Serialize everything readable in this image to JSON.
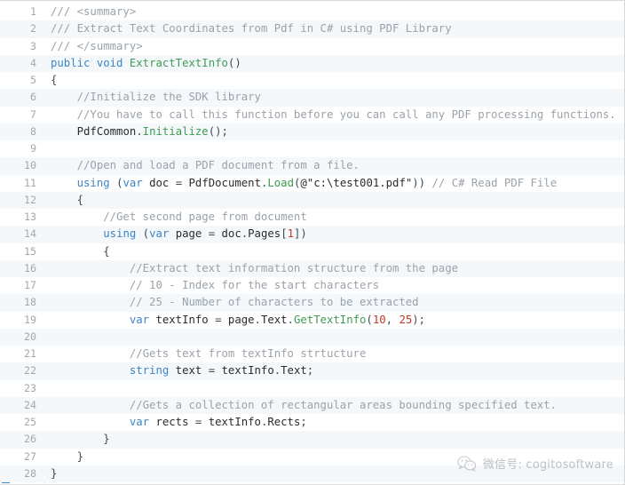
{
  "viewer": {
    "language": "csharp",
    "accent_color": "#4584c4",
    "stripe_color": "#f4f8fb",
    "background_color": "#ffffff",
    "gutter_text_color": "#a0a8b0",
    "total_lines": 28,
    "first_line_number": 1
  },
  "palette": {
    "comment": "#9aa2ab",
    "keyword": "#3d85c6",
    "method": "#3f9c52",
    "number": "#c0392b",
    "string": "#2b2b2b",
    "punctuation": "#3b4a57",
    "plain": "#2b2b2b"
  },
  "watermark": {
    "icon": "wechat-icon",
    "label": "微信号: cogitosoftware"
  },
  "code": {
    "lines": [
      {
        "n": "1",
        "tokens": [
          {
            "c": "doc",
            "t": "/// <summary>"
          }
        ]
      },
      {
        "n": "2",
        "tokens": [
          {
            "c": "doc",
            "t": "/// Extract Text Coordinates from Pdf in C# using PDF Library"
          }
        ]
      },
      {
        "n": "3",
        "tokens": [
          {
            "c": "doc",
            "t": "/// </summary>"
          }
        ]
      },
      {
        "n": "4",
        "tokens": [
          {
            "c": "kw",
            "t": "public"
          },
          {
            "c": "plain",
            "t": " "
          },
          {
            "c": "kw",
            "t": "void"
          },
          {
            "c": "plain",
            "t": " "
          },
          {
            "c": "meth",
            "t": "ExtractTextInfo"
          },
          {
            "c": "punc",
            "t": "()"
          }
        ]
      },
      {
        "n": "5",
        "tokens": [
          {
            "c": "punc",
            "t": "{"
          }
        ]
      },
      {
        "n": "6",
        "tokens": [
          {
            "c": "com",
            "t": "    //Initialize the SDK library"
          }
        ]
      },
      {
        "n": "7",
        "tokens": [
          {
            "c": "com",
            "t": "    //You have to call this function before you can call any PDF processing functions."
          }
        ]
      },
      {
        "n": "8",
        "tokens": [
          {
            "c": "plain",
            "t": "    "
          },
          {
            "c": "type",
            "t": "PdfCommon"
          },
          {
            "c": "punc",
            "t": "."
          },
          {
            "c": "meth",
            "t": "Initialize"
          },
          {
            "c": "punc",
            "t": "();"
          }
        ]
      },
      {
        "n": "9",
        "tokens": [
          {
            "c": "plain",
            "t": ""
          }
        ]
      },
      {
        "n": "10",
        "tokens": [
          {
            "c": "com",
            "t": "    //Open and load a PDF document from a file."
          }
        ]
      },
      {
        "n": "11",
        "tokens": [
          {
            "c": "plain",
            "t": "    "
          },
          {
            "c": "kw",
            "t": "using"
          },
          {
            "c": "plain",
            "t": " "
          },
          {
            "c": "punc",
            "t": "("
          },
          {
            "c": "kw",
            "t": "var"
          },
          {
            "c": "plain",
            "t": " doc "
          },
          {
            "c": "punc",
            "t": "="
          },
          {
            "c": "plain",
            "t": " "
          },
          {
            "c": "type",
            "t": "PdfDocument"
          },
          {
            "c": "punc",
            "t": "."
          },
          {
            "c": "meth",
            "t": "Load"
          },
          {
            "c": "punc",
            "t": "("
          },
          {
            "c": "str",
            "t": "@\"c:\\test001.pdf\""
          },
          {
            "c": "punc",
            "t": "))"
          },
          {
            "c": "plain",
            "t": " "
          },
          {
            "c": "com",
            "t": "// C# Read PDF File"
          }
        ]
      },
      {
        "n": "12",
        "tokens": [
          {
            "c": "punc",
            "t": "    {"
          }
        ]
      },
      {
        "n": "13",
        "tokens": [
          {
            "c": "com",
            "t": "        //Get second page from document"
          }
        ]
      },
      {
        "n": "14",
        "tokens": [
          {
            "c": "plain",
            "t": "        "
          },
          {
            "c": "kw",
            "t": "using"
          },
          {
            "c": "plain",
            "t": " "
          },
          {
            "c": "punc",
            "t": "("
          },
          {
            "c": "kw",
            "t": "var"
          },
          {
            "c": "plain",
            "t": " page "
          },
          {
            "c": "punc",
            "t": "="
          },
          {
            "c": "plain",
            "t": " doc"
          },
          {
            "c": "punc",
            "t": "."
          },
          {
            "c": "plain",
            "t": "Pages"
          },
          {
            "c": "punc",
            "t": "["
          },
          {
            "c": "num",
            "t": "1"
          },
          {
            "c": "punc",
            "t": "])"
          }
        ]
      },
      {
        "n": "15",
        "tokens": [
          {
            "c": "punc",
            "t": "        {"
          }
        ]
      },
      {
        "n": "16",
        "tokens": [
          {
            "c": "com",
            "t": "            //Extract text information structure from the page"
          }
        ]
      },
      {
        "n": "17",
        "tokens": [
          {
            "c": "com",
            "t": "            // 10 - Index for the start characters"
          }
        ]
      },
      {
        "n": "18",
        "tokens": [
          {
            "c": "com",
            "t": "            // 25 - Number of characters to be extracted"
          }
        ]
      },
      {
        "n": "19",
        "tokens": [
          {
            "c": "plain",
            "t": "            "
          },
          {
            "c": "kw",
            "t": "var"
          },
          {
            "c": "plain",
            "t": " textInfo "
          },
          {
            "c": "punc",
            "t": "="
          },
          {
            "c": "plain",
            "t": " page"
          },
          {
            "c": "punc",
            "t": "."
          },
          {
            "c": "plain",
            "t": "Text"
          },
          {
            "c": "punc",
            "t": "."
          },
          {
            "c": "meth",
            "t": "GetTextInfo"
          },
          {
            "c": "punc",
            "t": "("
          },
          {
            "c": "num",
            "t": "10"
          },
          {
            "c": "punc",
            "t": ","
          },
          {
            "c": "plain",
            "t": " "
          },
          {
            "c": "num",
            "t": "25"
          },
          {
            "c": "punc",
            "t": ");"
          }
        ]
      },
      {
        "n": "20",
        "tokens": [
          {
            "c": "plain",
            "t": ""
          }
        ]
      },
      {
        "n": "21",
        "tokens": [
          {
            "c": "com",
            "t": "            //Gets text from textInfo strtucture"
          }
        ]
      },
      {
        "n": "22",
        "tokens": [
          {
            "c": "plain",
            "t": "            "
          },
          {
            "c": "kw",
            "t": "string"
          },
          {
            "c": "plain",
            "t": " text "
          },
          {
            "c": "punc",
            "t": "="
          },
          {
            "c": "plain",
            "t": " textInfo"
          },
          {
            "c": "punc",
            "t": "."
          },
          {
            "c": "plain",
            "t": "Text"
          },
          {
            "c": "punc",
            "t": ";"
          }
        ]
      },
      {
        "n": "23",
        "tokens": [
          {
            "c": "plain",
            "t": ""
          }
        ]
      },
      {
        "n": "24",
        "tokens": [
          {
            "c": "com",
            "t": "            //Gets a collection of rectangular areas bounding specified text."
          }
        ]
      },
      {
        "n": "25",
        "tokens": [
          {
            "c": "plain",
            "t": "            "
          },
          {
            "c": "kw",
            "t": "var"
          },
          {
            "c": "plain",
            "t": " rects "
          },
          {
            "c": "punc",
            "t": "="
          },
          {
            "c": "plain",
            "t": " textInfo"
          },
          {
            "c": "punc",
            "t": "."
          },
          {
            "c": "plain",
            "t": "Rects"
          },
          {
            "c": "punc",
            "t": ";"
          }
        ]
      },
      {
        "n": "26",
        "tokens": [
          {
            "c": "punc",
            "t": "        }"
          }
        ]
      },
      {
        "n": "27",
        "tokens": [
          {
            "c": "punc",
            "t": "    }"
          }
        ]
      },
      {
        "n": "28",
        "tokens": [
          {
            "c": "punc",
            "t": "}"
          }
        ]
      }
    ]
  }
}
